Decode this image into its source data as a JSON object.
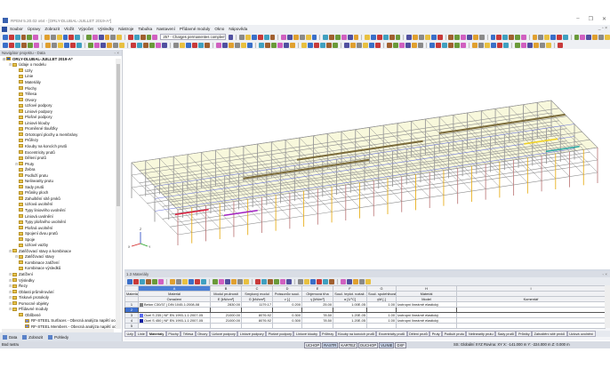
{
  "window": {
    "title": "RFEM 5.20.02 x64 - [ORLY-DLUBAL-JUILLET 2019-A*]",
    "controls": [
      "–",
      "❐",
      "✕"
    ]
  },
  "menu": [
    "Soubor",
    "Úpravy",
    "Zobrazit",
    "Vložit",
    "Výpočet",
    "Výsledky",
    "Nástroje",
    "Tabulka",
    "Nastavení",
    "Přídavné moduly",
    "Okno",
    "Nápověda"
  ],
  "mdi_controls": "_ ▫ ×",
  "toolbar": {
    "load_case": "257 - Charges permanentes compleme"
  },
  "navigator": {
    "title": "Navigátor projektu - Data",
    "panel_controls": "▫ ×",
    "items": [
      {
        "label": "ORLY-DLUBAL-JUILLET 2019-A*",
        "level": 0,
        "bold": true
      },
      {
        "label": "Údaje o modelu",
        "level": 1
      },
      {
        "label": "Uzly",
        "level": 2
      },
      {
        "label": "Linie",
        "level": 2
      },
      {
        "label": "Materiály",
        "level": 2
      },
      {
        "label": "Plochy",
        "level": 2
      },
      {
        "label": "Tělesa",
        "level": 2
      },
      {
        "label": "Otvory",
        "level": 2
      },
      {
        "label": "Uzlové podpory",
        "level": 2
      },
      {
        "label": "Liniové podpory",
        "level": 2
      },
      {
        "label": "Plošné podpory",
        "level": 2
      },
      {
        "label": "Liniové klouby",
        "level": 2
      },
      {
        "label": "Proměnné tloušťky",
        "level": 2
      },
      {
        "label": "Ortotropní plochy a membrány",
        "level": 2
      },
      {
        "label": "Průřezy",
        "level": 2
      },
      {
        "label": "Klouby na koncích prutů",
        "level": 2
      },
      {
        "label": "Excentricity prutů",
        "level": 2
      },
      {
        "label": "Dělení prutů",
        "level": 2
      },
      {
        "label": "Pruty",
        "level": 2
      },
      {
        "label": "Žebra",
        "level": 2
      },
      {
        "label": "Podloží prutu",
        "level": 2
      },
      {
        "label": "Nelinearity prutu",
        "level": 2
      },
      {
        "label": "Sady prutů",
        "level": 2
      },
      {
        "label": "Průniky ploch",
        "level": 2
      },
      {
        "label": "Zahuštění sítě prvků",
        "level": 2
      },
      {
        "label": "Uzlová uvolnění",
        "level": 2
      },
      {
        "label": "Typy liniového uvolnění",
        "level": 2
      },
      {
        "label": "Liniová uvolnění",
        "level": 2
      },
      {
        "label": "Typy plošného uvolnění",
        "level": 2
      },
      {
        "label": "Plošná uvolnění",
        "level": 2
      },
      {
        "label": "Spojení dvou prutů",
        "level": 2
      },
      {
        "label": "Spoje",
        "level": 2
      },
      {
        "label": "Uzlové vazby",
        "level": 2
      },
      {
        "label": "Zatěžovací stavy a kombinace",
        "level": 1
      },
      {
        "label": "Zatěžovací stavy",
        "level": 2
      },
      {
        "label": "Kombinace zatížení",
        "level": 2
      },
      {
        "label": "Kombinace výsledků",
        "level": 2
      },
      {
        "label": "Zatížení",
        "level": 1
      },
      {
        "label": "Výsledky",
        "level": 1
      },
      {
        "label": "Řezy",
        "level": 1
      },
      {
        "label": "Oblasti průměrování",
        "level": 1
      },
      {
        "label": "Tiskové protokoly",
        "level": 1
      },
      {
        "label": "Pomocné objekty",
        "level": 1
      },
      {
        "label": "Přídavné moduly",
        "level": 1
      },
      {
        "label": "Oblíbené",
        "level": 2
      },
      {
        "label": "RF-STEEL Surfaces - Obecná analýza napětí ocelových",
        "level": 3
      },
      {
        "label": "RF-STEEL Members - Obecná analýza napětí ocelových",
        "level": 3
      }
    ],
    "tabs": [
      "Data",
      "Zobrazit",
      "Pohledy"
    ]
  },
  "table": {
    "title": "1.3 Materiály",
    "panel_controls": "▫ ×",
    "letters": [
      "A",
      "B",
      "C",
      "D",
      "E",
      "F",
      "G",
      "H",
      "I"
    ],
    "headers": [
      [
        "Materiál č.",
        ""
      ],
      [
        "Materiál",
        "Označení"
      ],
      [
        "Modul pružnosti",
        "E [kN/cm²]"
      ],
      [
        "Smykový modul",
        "G [kN/cm²]"
      ],
      [
        "Poissonův souč.",
        "ν [-]"
      ],
      [
        "Objemová tíha",
        "γ [kN/m³]"
      ],
      [
        "Souč. teplot. roztaž.",
        "α [1/°C]"
      ],
      [
        "Souč. spolehlivosti",
        "γM [-]"
      ],
      [
        "Materiál",
        "Model"
      ],
      [
        "",
        "Komentář"
      ]
    ],
    "rows": [
      {
        "no": "1",
        "color": "#808080",
        "name": "Beton C30/37 | DIN 1045-1:2008-08",
        "E": "2830.00",
        "G": "1179.17",
        "nu": "0.200",
        "gamma": "25.00",
        "alpha": "1.00E-05",
        "gm": "1.00",
        "model": "Izotropní lineárně elastický",
        "comment": ""
      },
      {
        "no": "2",
        "color": "",
        "name": "",
        "E": "",
        "G": "",
        "nu": "",
        "gamma": "",
        "alpha": "",
        "gm": "",
        "model": "",
        "comment": "",
        "selected": true
      },
      {
        "no": "3",
        "color": "#5a6cf0",
        "name": "Ocel S 235 | NF EN 1993-1-1:2007-05",
        "E": "21000.00",
        "G": "8076.92",
        "nu": "0.300",
        "gamma": "78.50",
        "alpha": "1.20E-05",
        "gm": "1.00",
        "model": "Izotropní lineárně elastický",
        "comment": ""
      },
      {
        "no": "4",
        "color": "#1020a0",
        "name": "Ocel S 450 | NF EN 1993-1-1:2007-05",
        "E": "21000.00",
        "G": "8076.92",
        "nu": "0.300",
        "gamma": "78.50",
        "alpha": "1.20E-05",
        "gm": "1.00",
        "model": "Izotropní lineárně elastický",
        "comment": ""
      },
      {
        "no": "5",
        "color": "",
        "name": "",
        "E": "",
        "G": "",
        "nu": "",
        "gamma": "",
        "alpha": "",
        "gm": "",
        "model": "",
        "comment": ""
      }
    ],
    "sheet_tabs": [
      "Uzly",
      "Linie",
      "Materiály",
      "Plochy",
      "Tělesa",
      "Otvory",
      "Uzlové podpory",
      "Liniové podpory",
      "Plošné podpory",
      "Liniové klouby",
      "Průřezy",
      "Klouby na koncích prutů",
      "Excentricity prutů",
      "Dělení prutů",
      "Pruty",
      "Podloží prutu",
      "Nelinearity prutu",
      "Sady prutů",
      "Průniky",
      "Zahuštění sítě prvků",
      "Uzlová uvolnění"
    ],
    "active_tab": "Materiály"
  },
  "status": {
    "text": "Bod rastru",
    "toggles": [
      {
        "label": "UCHOP",
        "on": false
      },
      {
        "label": "RASTR",
        "on": true
      },
      {
        "label": "KARTEZ",
        "on": false
      },
      {
        "label": "OUCHOP",
        "on": false
      },
      {
        "label": "VLINIE",
        "on": true
      },
      {
        "label": "DXF",
        "on": false
      }
    ],
    "coords": "SS: Globální XYZ  Rovina: XY     X: -141.000 m  Y: -224.000 m  Z: 0.000 m"
  },
  "axes": {
    "x": "X",
    "y": "Y",
    "z": "Z"
  }
}
